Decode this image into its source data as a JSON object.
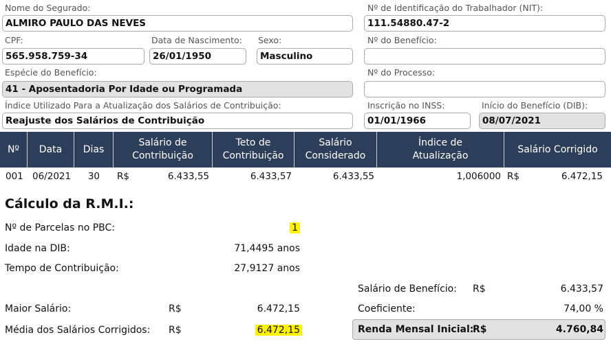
{
  "form": {
    "nome_label": "Nome do Segurado:",
    "nome_value": "ALMIRO PAULO DAS NEVES",
    "nit_label": "Nº de Identificação do Trabalhador (NIT):",
    "nit_value": "111.54880.47-2",
    "cpf_label": "CPF:",
    "cpf_value": "565.958.759-34",
    "nasc_label": "Data de Nascimento:",
    "nasc_value": "26/01/1950",
    "sexo_label": "Sexo:",
    "sexo_value": "Masculino",
    "beneficio_label": "Nº do Benefício:",
    "beneficio_value": "",
    "especie_label": "Espécie do Benefício:",
    "especie_value": "41 - Aposentadoria Por Idade ou Programada",
    "processo_label": "Nº do Processo:",
    "processo_value": "",
    "indice_label": "Índice Utilizado Para a Atualização dos Salários de Contribuição:",
    "indice_value": "Reajuste dos Salários de Contribuição",
    "inscricao_label": "Inscrição no INSS:",
    "inscricao_value": "01/01/1966",
    "dib_label": "Início do Benefício (DIB):",
    "dib_value": "08/07/2021"
  },
  "table": {
    "headers": [
      "Nº",
      "Data",
      "Dias",
      "Salário de Contribuição",
      "Teto de Contribuição",
      "Salário Considerado",
      "Índice de Atualização",
      "Salário Corrigido"
    ],
    "rows": [
      {
        "n": "001",
        "data": "06/2021",
        "dias": "30",
        "cur1": "R$",
        "salario": "6.433,55",
        "teto": "6.433,57",
        "considerado": "6.433,55",
        "indice": "1,006000",
        "cur2": "R$",
        "corrigido": "6.472,15"
      }
    ]
  },
  "calc": {
    "title": "Cálculo da R.M.I.:",
    "parcelas_label": "Nº de Parcelas no PBC:",
    "parcelas_value": "1",
    "idade_label": "Idade na DIB:",
    "idade_value": "71,4495 anos",
    "tempo_label": "Tempo de Contribuição:",
    "tempo_value": "27,9127 anos",
    "maior_label": "Maior Salário:",
    "maior_cur": "R$",
    "maior_value": "6.472,15",
    "media_label": "Média dos Salários Corrigidos:",
    "media_cur": "R$",
    "media_value": "6.472,15",
    "sb_label": "Salário de Benefício:",
    "sb_cur": "R$",
    "sb_value": "6.433,57",
    "coef_label": "Coeficiente:",
    "coef_value": "74,00 %",
    "rmi_label": "Renda Mensal Inicial:",
    "rmi_cur": "R$",
    "rmi_value": "4.760,84"
  },
  "colors": {
    "header_bg": "#2d3e5a",
    "highlight": "#fff200",
    "readonly_bg": "#e2e2e2"
  }
}
